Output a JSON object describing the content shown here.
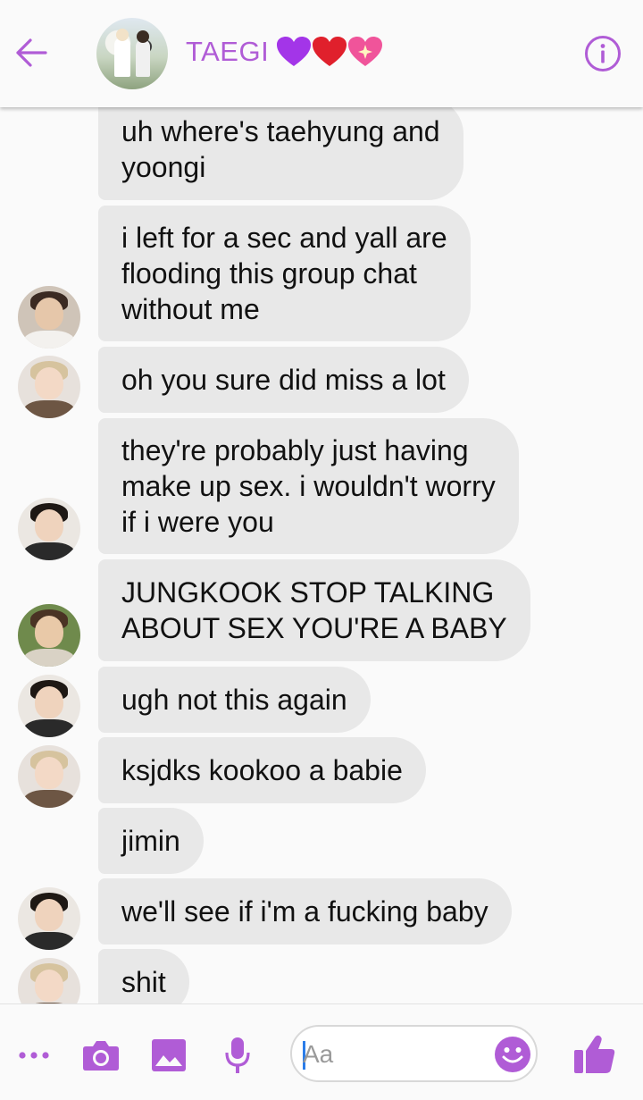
{
  "header": {
    "title": "TAEGI",
    "title_emojis": [
      "purple-heart",
      "red-heart",
      "sparkling-heart"
    ],
    "accent_color": "#b05cd6"
  },
  "messages": [
    {
      "lines": [
        "uh where's taehyung and",
        "yoongi"
      ],
      "avatar": null
    },
    {
      "lines": [
        "i left for a sec and yall are",
        "flooding this group chat",
        "without me"
      ],
      "avatar": "hoseok"
    },
    {
      "lines": [
        "oh you sure did miss a lot"
      ],
      "avatar": "jimin"
    },
    {
      "lines": [
        "they're probably just having",
        "make up sex. i wouldn't worry",
        "if i were you"
      ],
      "avatar": "jungkook"
    },
    {
      "lines": [
        "JUNGKOOK STOP TALKING",
        "ABOUT SEX YOU'RE A BABY"
      ],
      "avatar": "seokjin"
    },
    {
      "lines": [
        "ugh not this again"
      ],
      "avatar": "jungkook"
    },
    {
      "lines": [
        "ksjdks kookoo a babie"
      ],
      "avatar": "jimin"
    },
    {
      "lines": [
        "jimin"
      ],
      "avatar": null
    },
    {
      "lines": [
        "we'll see if i'm a fucking baby"
      ],
      "avatar": "jungkook"
    },
    {
      "lines": [
        "shit"
      ],
      "avatar": "jimin"
    }
  ],
  "composer": {
    "placeholder": "Aa",
    "value": ""
  },
  "colors": {
    "bubble": "#e8e8e8",
    "icon": "#b05cd6",
    "background": "#fafafa"
  }
}
